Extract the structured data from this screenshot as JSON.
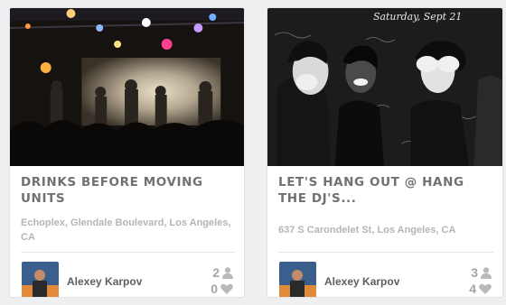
{
  "cards": [
    {
      "title": "DRINKS BEFORE MOVING UNITS",
      "venue": "Echoplex, Glendale Boulevard, Los Angeles, CA",
      "user": "Alexey Karpov",
      "attendees": "2",
      "likes": "0",
      "photo_alt": "concert stage with band"
    },
    {
      "title": "LET'S HANG OUT @ HANG THE DJ'S...",
      "venue": "637 S Carondelet St, Los Angeles, CA",
      "user": "Alexey Karpov",
      "attendees": "3",
      "likes": "4",
      "photo_alt": "black and white photo of three women at a party",
      "photo_text": [
        "Saturday, Sept 21"
      ]
    }
  ],
  "icons": {
    "person": "person-icon",
    "heart": "heart-icon"
  }
}
